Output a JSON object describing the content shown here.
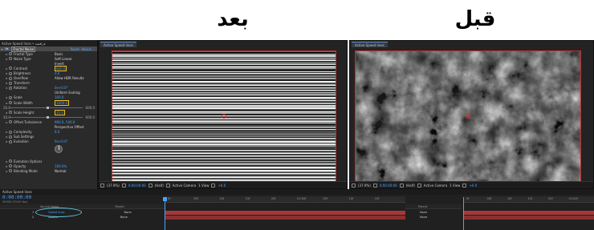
{
  "captions": {
    "after": "بعد",
    "before": "قبل"
  },
  "effects_panel": {
    "tab_title": "Active Speed lines • فراقشة",
    "effect": {
      "fx_badge": "fx",
      "name": "Fractal Noise",
      "reset": "Reset",
      "about": "About..."
    },
    "rows": [
      {
        "label": "Fractal Type",
        "value": "Basic",
        "kind": "txt"
      },
      {
        "label": "Noise Type",
        "value": "Soft Linear",
        "kind": "txt"
      },
      {
        "label": "",
        "value": "Invert",
        "kind": "txt"
      },
      {
        "label": "Contrast",
        "value": "820.0",
        "kind": "val",
        "hl": true
      },
      {
        "label": "Brightness",
        "value": "0.0",
        "kind": "val"
      },
      {
        "label": "Overflow",
        "value": "Allow HDR Results",
        "kind": "txt"
      },
      {
        "label": "Transform",
        "value": "",
        "kind": "txt"
      },
      {
        "label": "Rotation",
        "value": "0x+0.0°",
        "kind": "val"
      },
      {
        "label": "",
        "value": "Uniform Scaling",
        "kind": "txt"
      },
      {
        "label": "Scale",
        "value": "100.0",
        "kind": "val"
      },
      {
        "label": "Scale Width",
        "value": "1000.0",
        "kind": "val",
        "hl": true
      },
      {
        "label": "",
        "value": "",
        "kind": "slider"
      },
      {
        "label": "Scale Height",
        "value": "35.0",
        "kind": "val",
        "hl": true
      },
      {
        "label": "",
        "value": "",
        "kind": "slider"
      },
      {
        "label": "Offset Turbulence",
        "value": "960.0, 540.0",
        "kind": "val"
      },
      {
        "label": "",
        "value": "Perspective Offset",
        "kind": "txt"
      },
      {
        "label": "Complexity",
        "value": "6.0",
        "kind": "val"
      },
      {
        "label": "Sub Settings",
        "value": "",
        "kind": "txt"
      },
      {
        "label": "Evolution",
        "value": "0x+0.0°",
        "kind": "val"
      },
      {
        "label": "",
        "value": "",
        "kind": "dial"
      },
      {
        "label": "",
        "value": "",
        "kind": "txt"
      },
      {
        "label": "Evolution Options",
        "value": "",
        "kind": "txt"
      },
      {
        "label": "Opacity",
        "value": "100.0%",
        "kind": "val"
      },
      {
        "label": "Blending Mode",
        "value": "Normal",
        "kind": "txt"
      }
    ],
    "slider_min": "20.0",
    "slider_max": "600.0"
  },
  "comp_after": {
    "tab": "Active Speed lines",
    "bar": {
      "zoom": "(37.9%)",
      "time": "0:00:00:00",
      "res": "(Half)",
      "camera": "Active Camera",
      "view": "1 View",
      "exposure": "+0.0"
    }
  },
  "comp_before": {
    "tab": "Active Speed lines",
    "bar": {
      "zoom": "(37.9%)",
      "time": "0:00:00:00",
      "res": "(Half)",
      "camera": "Active Camera",
      "view": "1 View",
      "exposure": "+0.0"
    }
  },
  "timeline": {
    "tab": "Active Speed lines",
    "time": "0:00:00:00",
    "fps": "00000 (25.00 fps)",
    "columns": {
      "source": "Source Name",
      "parent": "Parent"
    },
    "layers": [
      {
        "num": "1",
        "name": "Speed lines",
        "parent": "None"
      },
      {
        "num": "2",
        "name": "Assets",
        "parent": "None"
      }
    ],
    "ticks_left": [
      "0f",
      "05f",
      "10f",
      "15f",
      "20f",
      "01:00f",
      "05f",
      "10f",
      "15f"
    ],
    "ticks_right": [
      "0f",
      "05f",
      "10f",
      "15f",
      "20f",
      "01:00f"
    ]
  },
  "colors": {
    "accent": "#4aa4ff",
    "selection": "#d03030",
    "highlight": "#f0c020",
    "layer_red": "#b03a3a"
  }
}
